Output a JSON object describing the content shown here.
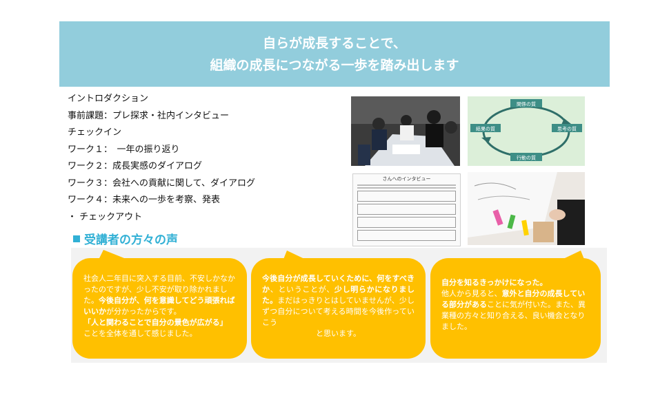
{
  "banner": {
    "line1": "自らが成長することで、",
    "line2": "組織の成長につながる一歩を踏み出します"
  },
  "agenda": [
    "イントロダクション",
    "事前課題：プレ探求・社内インタビュー",
    "チェックイン",
    "ワーク１：　一年の振り返り",
    "ワーク２：成長実感のダイアログ",
    "ワーク３：会社への貢献に関して、ダイアログ",
    "ワーク４：未来への一歩を考察、発表",
    "・ チェックアウト"
  ],
  "voices_title": "受講者の方々の声",
  "cycle": {
    "top": "関係の質",
    "right": "思考の質",
    "bottom": "行動の質",
    "left": "結果の質"
  },
  "sheet_title": "さんへのインタビュー",
  "voices": [
    {
      "t1": "社会人二年目に突入する目前、不安しかなかったのですが、少し不安が取り除かれました。",
      "b1": "今後自分が、何を意識してどう頑張ればいいか",
      "t2": "が分かったからです。",
      "b2": "「人と関わることで自分の景色が広がる」",
      "t3": "ことを全体を通して感じました。"
    },
    {
      "b1": "今後自分が成長していくために、何をすべきか",
      "t1": "、ということが、",
      "b2": "少し明らかになりました。",
      "t2": "まだはっきりとはしていませんが、少しずつ自分について考える時間を今後作っていこう",
      "t3": "と思います。"
    },
    {
      "b1": "自分を知るきっかけになった。",
      "t1": "他人から見ると、",
      "b2": "意外と自分の成長している部分がある",
      "t2": "ことに気が付いた。また、異業種の方々と知り合える、良い機会となりました。"
    }
  ],
  "colors": {
    "banner": "#92cddc",
    "accent": "#31b0d5",
    "bubble": "#ffc000",
    "panel": "#f2f2f2",
    "cycle_box": "#3d8e86"
  }
}
